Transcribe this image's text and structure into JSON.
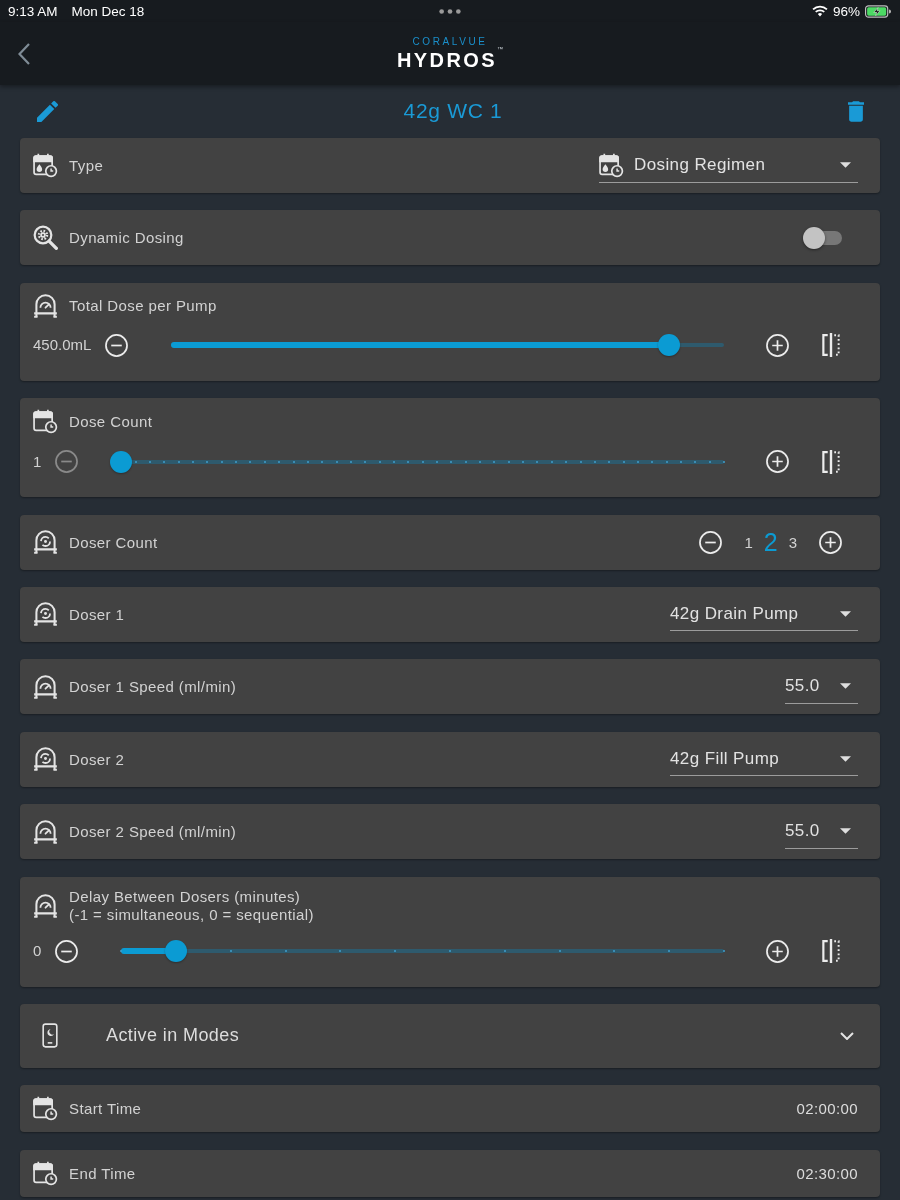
{
  "status_bar": {
    "time": "9:13 AM",
    "date": "Mon Dec 18",
    "battery": "96%"
  },
  "header": {
    "brand_small": "CORALVUE",
    "brand": "HYDROS",
    "trademark": "™"
  },
  "title_bar": {
    "title": "42g WC 1"
  },
  "rows": [
    {
      "kind": "select",
      "label": "Type",
      "value": "Dosing Regimen"
    },
    {
      "kind": "toggle",
      "label": "Dynamic Dosing",
      "on": false
    },
    {
      "kind": "slider",
      "label": "Total Dose per Pump",
      "reading": "450.0mL",
      "level": 0.9,
      "minus_disabled": false
    },
    {
      "kind": "slider",
      "label": "Dose Count",
      "reading": "1",
      "level": 0,
      "minus_disabled": true
    },
    {
      "kind": "stepper",
      "label": "Doser Count",
      "options": [
        {
          "label": "1",
          "selected": false
        },
        {
          "label": "2",
          "selected": true
        },
        {
          "label": "3",
          "selected": false
        }
      ]
    },
    {
      "kind": "select",
      "label": "Doser 1",
      "value": "42g Drain Pump"
    },
    {
      "kind": "select",
      "label": "Doser 1 Speed (ml/min)",
      "value": "55.0"
    },
    {
      "kind": "select",
      "label": "Doser 2",
      "value": "42g Fill Pump"
    },
    {
      "kind": "select",
      "label": "Doser 2 Speed (ml/min)",
      "value": "55.0"
    },
    {
      "kind": "slider",
      "label": "Delay Between Dosers (minutes)",
      "sublabel": "(-1 = simultaneous, 0 = sequential)",
      "reading": "0",
      "level": 0.09,
      "minus_disabled": false
    },
    {
      "kind": "expander",
      "label": "Active in Modes",
      "expanded": false
    },
    {
      "kind": "time",
      "label": "Start Time",
      "value": "02:00:00"
    },
    {
      "kind": "time",
      "label": "End Time",
      "value": "02:30:00"
    }
  ]
}
